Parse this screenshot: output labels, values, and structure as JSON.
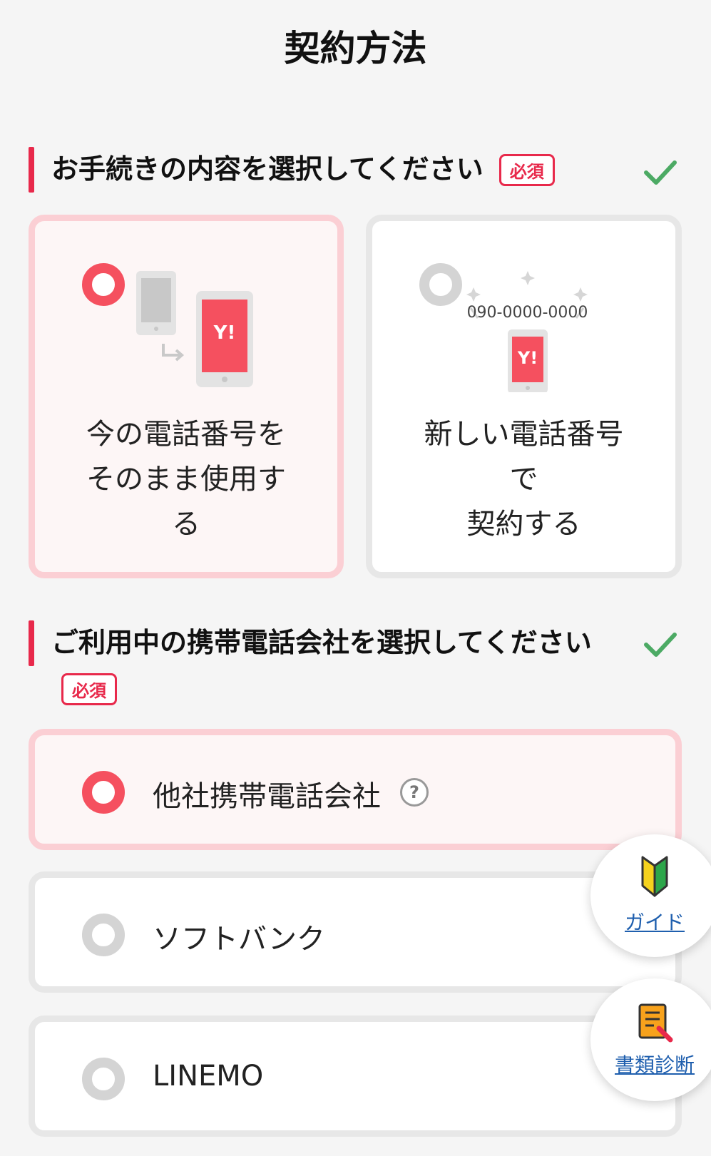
{
  "page": {
    "title": "契約方法"
  },
  "section1": {
    "title": "お手続きの内容を選択してください",
    "required_label": "必須",
    "options": [
      {
        "label": "今の電話番号を\nそのまま使用す\nる",
        "phone_logo": "Y!",
        "selected": true
      },
      {
        "label": "新しい電話番号\nで\n契約する",
        "phone_number": "090-0000-0000",
        "phone_logo": "Y!",
        "selected": false
      }
    ]
  },
  "section2": {
    "title": "ご利用中の携帯電話会社を選択してください",
    "required_label": "必須",
    "options": [
      {
        "label": "他社携帯電話会社",
        "help": "?",
        "selected": true
      },
      {
        "label": "ソフトバンク",
        "selected": false
      },
      {
        "label": "LINEMO",
        "selected": false
      }
    ]
  },
  "fabs": {
    "guide": {
      "label": "ガイド",
      "icon": "beginner-mark-icon"
    },
    "docs": {
      "label": "書類診断",
      "icon": "document-check-icon"
    }
  },
  "colors": {
    "accent": "#e8294b",
    "radio_on": "#f5505f",
    "check": "#4caa64",
    "link": "#1f5fae"
  }
}
